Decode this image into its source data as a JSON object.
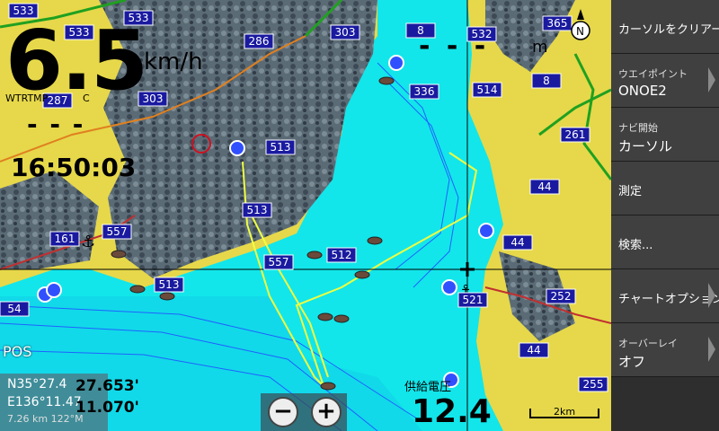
{
  "overlay": {
    "speed_value": "6.5",
    "speed_unit": "km/h",
    "water_temp_label": "WTRTMP",
    "water_temp_unit": "C",
    "water_temp_value": "- - -",
    "clock": "16:50:03",
    "depth_value": "- - -",
    "depth_unit": "m",
    "position_label": "POS",
    "coord_n": "N35°27.4",
    "coord_e": "E136°11.47",
    "coord_n_large": "27.653'",
    "coord_e_large": "11.070'",
    "distance_bearing": "7.26 km 122°M",
    "voltage_label": "供給電圧",
    "voltage_value": "12.4",
    "scale_label": "2km",
    "zoom_out_label": "−",
    "zoom_in_label": "+",
    "compass_label": "N"
  },
  "map": {
    "route_labels": [
      "533",
      "533",
      "533",
      "286",
      "303",
      "8",
      "532",
      "365",
      "287",
      "303",
      "336",
      "514",
      "8",
      "513",
      "513",
      "161",
      "557",
      "512",
      "557",
      "513",
      "261",
      "44",
      "44",
      "521",
      "252",
      "44",
      "255",
      "54"
    ]
  },
  "menu": {
    "items": [
      {
        "line1": "カーソルをクリアー",
        "line2": "",
        "has_submenu": false
      },
      {
        "line1": "ウエイポイント",
        "line2": "ONOE2",
        "has_submenu": true
      },
      {
        "line1": "ナビ開始",
        "line2": "カーソル",
        "has_submenu": false
      },
      {
        "line1": "",
        "line2": "測定",
        "has_submenu": false
      },
      {
        "line1": "",
        "line2": "検索...",
        "has_submenu": false
      },
      {
        "line1": "チャートオプション",
        "line2": "",
        "has_submenu": true
      },
      {
        "line1": "オーバーレイ",
        "line2": "オフ",
        "has_submenu": true
      }
    ]
  },
  "colors": {
    "water": "#12e6ea",
    "land": "#e6d84a",
    "forest": "#5a6a7a",
    "route_shield": "#1a1aa0",
    "menu_bg": "#404040"
  }
}
